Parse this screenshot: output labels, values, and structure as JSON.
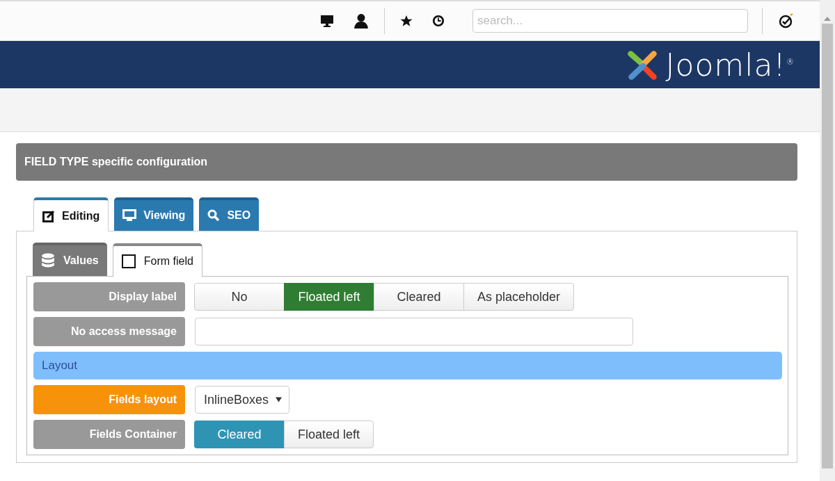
{
  "search": {
    "placeholder": "search..."
  },
  "header": {
    "logo_text": "Joomla!$^{®}$"
  },
  "panel": {
    "title": "FIELD TYPE specific configuration"
  },
  "tabs": [
    {
      "label": "Editing",
      "selected": true
    },
    {
      "label": "Viewing",
      "selected": false
    },
    {
      "label": "SEO",
      "selected": false
    }
  ],
  "subtabs": [
    {
      "label": "Values",
      "selected": false
    },
    {
      "label": "Form field",
      "selected": true
    }
  ],
  "rows": [
    {
      "kind": "radio",
      "label": "Display label",
      "color": "#999999",
      "options": [
        {
          "label": "No",
          "selected": false,
          "color": "#eeeeee"
        },
        {
          "label": "Floated left",
          "selected": true,
          "color": "#2f7d32"
        },
        {
          "label": "Cleared",
          "selected": false,
          "color": "#eeeeee"
        },
        {
          "label": "As placeholder",
          "selected": false,
          "color": "#eeeeee"
        }
      ]
    },
    {
      "kind": "text",
      "label": "No access message",
      "color": "#999999"
    },
    {
      "kind": "section",
      "label": "Layout"
    },
    {
      "kind": "select",
      "label": "Fields layout",
      "color": "#f7930a",
      "value": "InlineBoxes"
    },
    {
      "kind": "radio",
      "label": "Fields Container",
      "color": "#999999",
      "options": [
        {
          "label": "Cleared",
          "selected": true,
          "color": "#2f94b4"
        },
        {
          "label": "Floated left",
          "selected": false,
          "color": "#eeeeee"
        }
      ]
    }
  ]
}
